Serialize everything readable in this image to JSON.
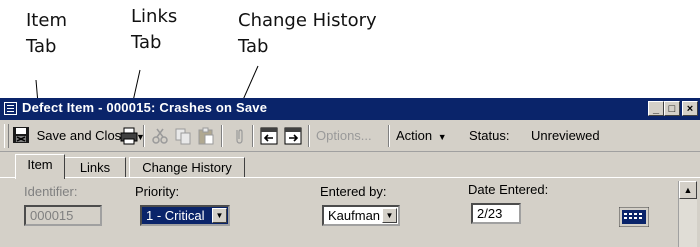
{
  "callouts": {
    "item_tab": [
      "Item",
      "Tab"
    ],
    "links_tab": [
      "Links",
      "Tab"
    ],
    "history_tab": [
      "Change History",
      "Tab"
    ]
  },
  "window": {
    "title": "Defect Item - 000015: Crashes on Save",
    "icon": "form-icon",
    "controls": [
      "minimize",
      "maximize",
      "close"
    ]
  },
  "toolbar": {
    "save_close_label": "Save and Close",
    "options_label": "Options...",
    "action_label": "Action",
    "status_label": "Status:",
    "status_value": "Unreviewed",
    "icons": [
      "save-icon",
      "print-icon",
      "cut-icon",
      "copy-icon",
      "paste-icon",
      "attach-icon",
      "previous-item-icon",
      "next-item-icon"
    ]
  },
  "tabs": [
    {
      "label": "Item",
      "active": true
    },
    {
      "label": "Links",
      "active": false
    },
    {
      "label": "Change History",
      "active": false
    }
  ],
  "form": {
    "identifier_label": "Identifier:",
    "identifier_value": "000015",
    "priority_label": "Priority:",
    "priority_value": "1 - Critical",
    "entered_by_label": "Entered by:",
    "entered_by_value": "Kaufman",
    "date_entered_label": "Date Entered:",
    "date_entered_value": "2/23"
  },
  "colors": {
    "titlebar": "#0a246a",
    "chrome": "#d4d0c8",
    "selection": "#0a246a"
  }
}
